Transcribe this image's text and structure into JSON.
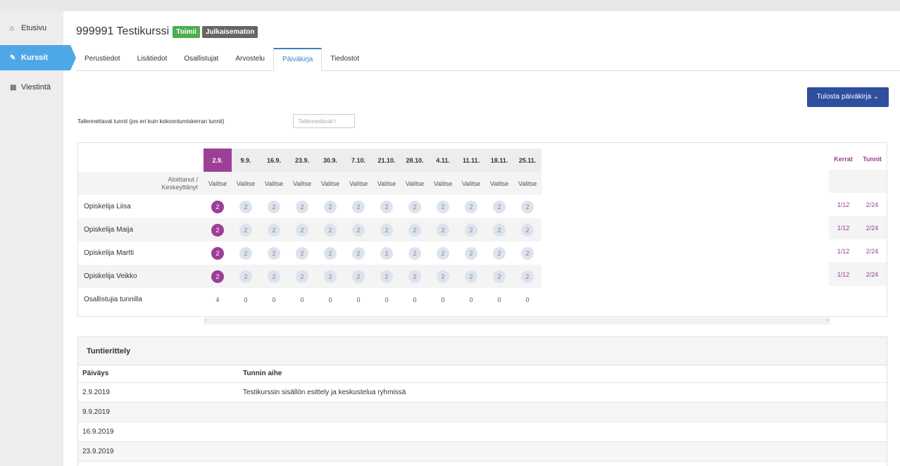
{
  "sidebar": {
    "items": [
      {
        "label": "Etusivu",
        "icon": "home-icon",
        "active": false
      },
      {
        "label": "Kurssit",
        "icon": "pencil-icon",
        "active": true
      },
      {
        "label": "Viestintä",
        "icon": "chat-icon",
        "active": false
      }
    ]
  },
  "header": {
    "title": "999991 Testikurssi",
    "badge_status": "Toimii",
    "badge_publish": "Julkaisematon"
  },
  "tabs": [
    "Perustiedot",
    "Lisätiedot",
    "Osallistujat",
    "Arvostelu",
    "Päiväkirja",
    "Tiedostot"
  ],
  "active_tab": "Päiväkirja",
  "print_button": "Tulosta päiväkirja ⌄",
  "hours": {
    "label": "Tallennettavat tunnit (jos eri kuin kokoontumiskerran tunnit)",
    "placeholder": "Tallennettavat t"
  },
  "attendance": {
    "dates": [
      "2.9.",
      "9.9.",
      "16.9.",
      "23.9.",
      "30.9.",
      "7.10.",
      "21.10.",
      "28.10.",
      "4.11.",
      "11.11.",
      "18.11.",
      "25.11."
    ],
    "selected_date": "2.9.",
    "status_label_1": "Aloittanut /",
    "status_label_2": "Keskeyttänyt",
    "select_label": "Valitse",
    "students": [
      {
        "name": "Opiskelija Liisa",
        "marks": [
          "2",
          "2",
          "2",
          "2",
          "2",
          "2",
          "2",
          "2",
          "2",
          "2",
          "2",
          "2"
        ],
        "kerrat": "1/12",
        "tunnit": "2/24"
      },
      {
        "name": "Opiskelija Maija",
        "marks": [
          "2",
          "2",
          "2",
          "2",
          "2",
          "2",
          "2",
          "2",
          "2",
          "2",
          "2",
          "2"
        ],
        "kerrat": "1/12",
        "tunnit": "2/24"
      },
      {
        "name": "Opiskelija Martti",
        "marks": [
          "2",
          "2",
          "2",
          "2",
          "2",
          "2",
          "2",
          "2",
          "2",
          "2",
          "2",
          "2"
        ],
        "kerrat": "1/12",
        "tunnit": "2/24"
      },
      {
        "name": "Opiskelija Veikko",
        "marks": [
          "2",
          "2",
          "2",
          "2",
          "2",
          "2",
          "2",
          "2",
          "2",
          "2",
          "2",
          "2"
        ],
        "kerrat": "1/12",
        "tunnit": "2/24"
      }
    ],
    "totals_label": "Osallistujia tunnilla",
    "totals": [
      "4",
      "0",
      "0",
      "0",
      "0",
      "0",
      "0",
      "0",
      "0",
      "0",
      "0",
      "0"
    ],
    "kerrat_header": "Kerrat",
    "tunnit_header": "Tunnit",
    "scroll_left": "‹",
    "scroll_right": "›"
  },
  "tuntierittely": {
    "title": "Tuntierittely",
    "col_date": "Päiväys",
    "col_topic": "Tunnin aihe",
    "rows": [
      {
        "date": "2.9.2019",
        "topic": "Testikurssin sisällön esittely ja keskustelua ryhmissä"
      },
      {
        "date": "9.9.2019",
        "topic": ""
      },
      {
        "date": "16.9.2019",
        "topic": ""
      },
      {
        "date": "23.9.2019",
        "topic": ""
      }
    ]
  },
  "colors": {
    "accent": "#9c3f97",
    "sidebar_active": "#4ea8e8",
    "primary_button": "#2d4f9e",
    "badge_green": "#4cae4c",
    "badge_gray": "#666666"
  }
}
